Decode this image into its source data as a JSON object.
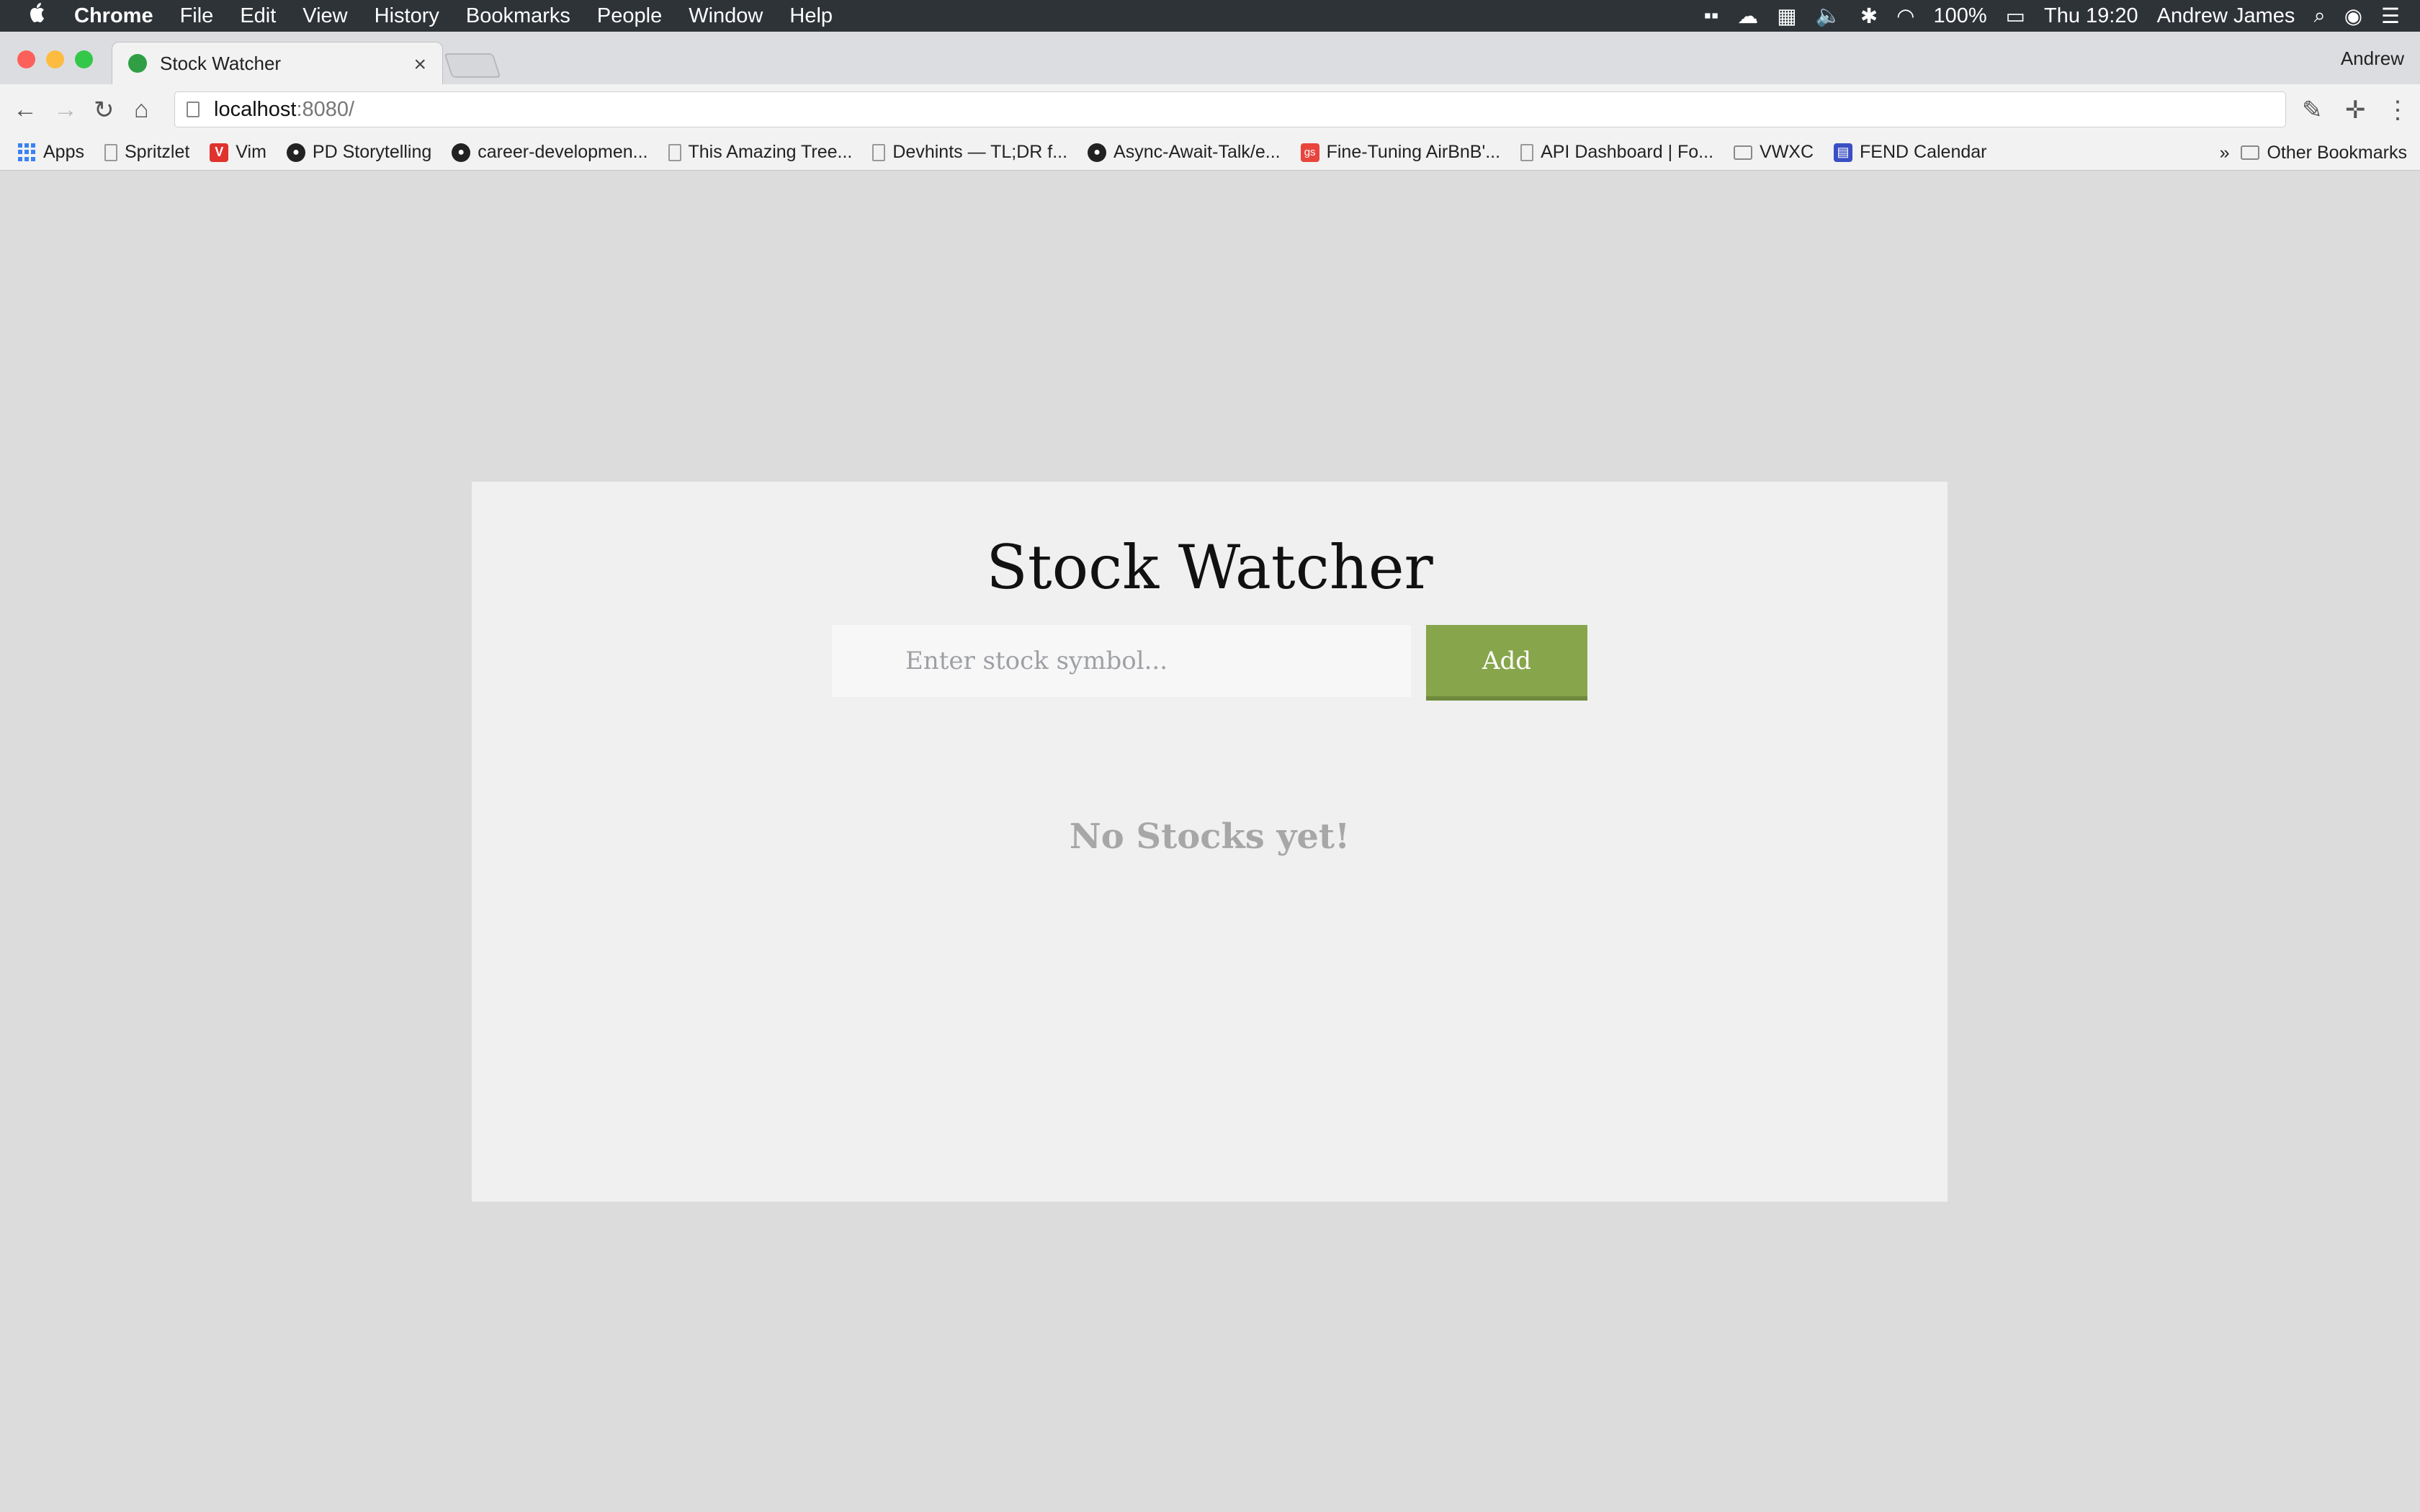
{
  "menubar": {
    "app": "Chrome",
    "items": [
      "File",
      "Edit",
      "View",
      "History",
      "Bookmarks",
      "People",
      "Window",
      "Help"
    ],
    "battery": "100%",
    "clock": "Thu 19:20",
    "user": "Andrew James"
  },
  "tab": {
    "title": "Stock Watcher",
    "close": "×"
  },
  "profile": "Andrew",
  "address": {
    "host": "localhost",
    "port": ":8080/"
  },
  "bookmarks": {
    "items": [
      "Apps",
      "Spritzlet",
      "Vim",
      "PD Storytelling",
      "career-developmen...",
      "This Amazing Tree...",
      "Devhints — TL;DR f...",
      "Async-Await-Talk/e...",
      "Fine-Tuning AirBnB'...",
      "API Dashboard | Fo...",
      "VWXC",
      "FEND Calendar"
    ],
    "chevron": "»",
    "other": "Other Bookmarks"
  },
  "app": {
    "title": "Stock Watcher",
    "input_placeholder": "Enter stock symbol...",
    "add_label": "Add",
    "empty_message": "No Stocks yet!"
  },
  "colors": {
    "accent": "#87a64c",
    "card_bg": "#f0f0f0",
    "page_bg": "#dcdcdc"
  }
}
